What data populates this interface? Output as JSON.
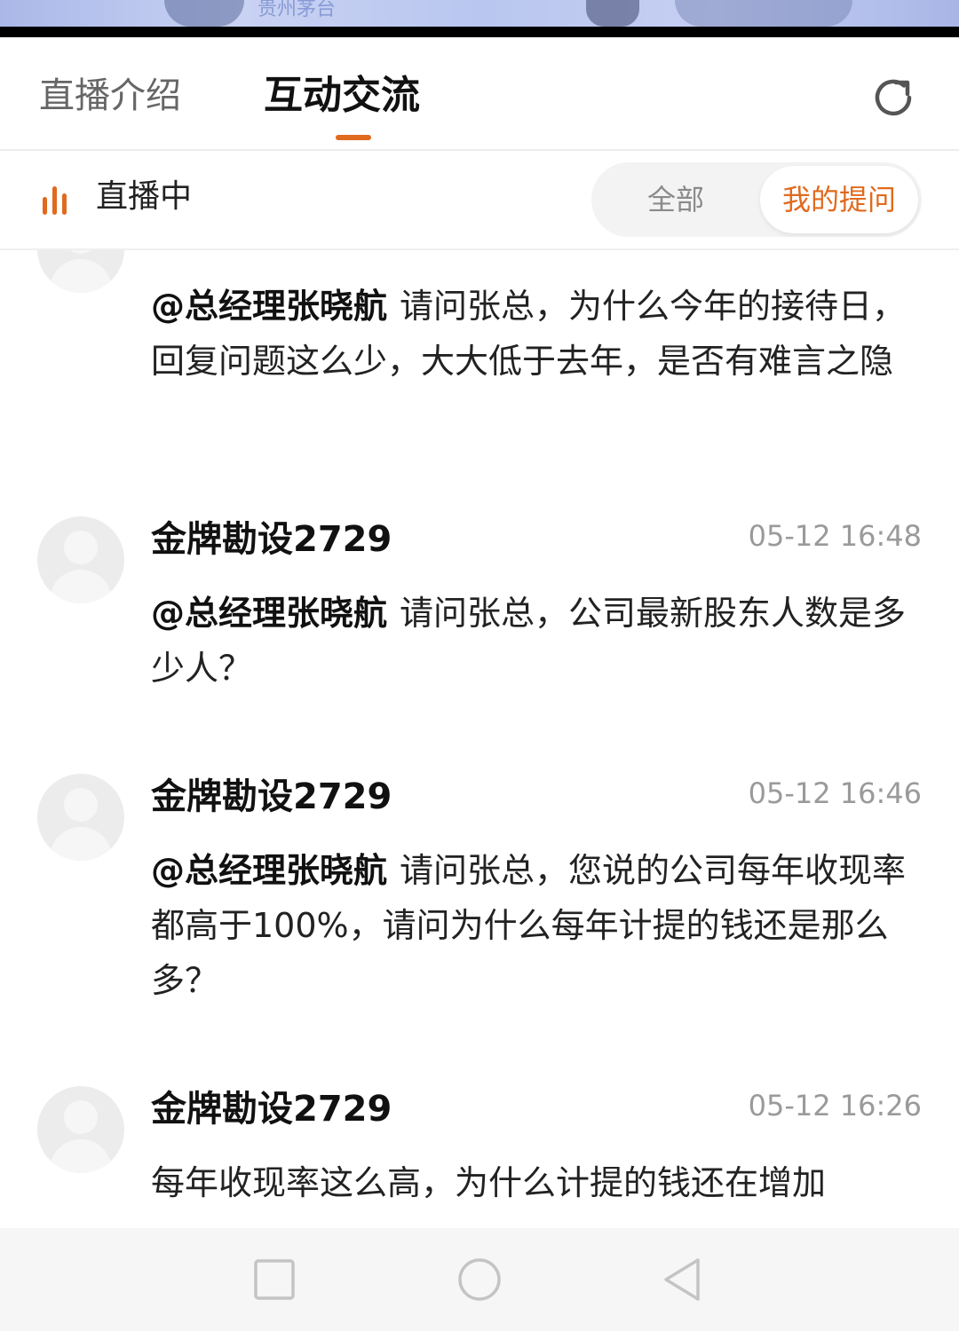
{
  "video": {
    "watermark": "贵州茅台"
  },
  "tabs": {
    "intro": "直播介绍",
    "chat": "互动交流"
  },
  "live": {
    "status": "直播中",
    "filter_all": "全部",
    "filter_mine": "我的提问"
  },
  "colors": {
    "accent": "#e06a1e"
  },
  "messages": [
    {
      "mention": "@总经理张晓航",
      "text": "请问张总，为什么今年的接待日，回复问题这么少，大大低于去年，是否有难言之隐"
    },
    {
      "user": "金牌勘设2729",
      "time": "05-12 16:48",
      "mention": "@总经理张晓航",
      "text": "请问张总，公司最新股东人数是多少人？"
    },
    {
      "user": "金牌勘设2729",
      "time": "05-12 16:46",
      "mention": "@总经理张晓航",
      "text": "请问张总，您说的公司每年收现率都高于100%，请问为什么每年计提的钱还是那么多？"
    },
    {
      "user": "金牌勘设2729",
      "time": "05-12 16:26",
      "text": "每年收现率这么高，为什么计提的钱还在增加"
    }
  ],
  "icons": {
    "refresh": "refresh-icon",
    "live": "live-bars-icon",
    "nav_recent": "square-icon",
    "nav_home": "circle-icon",
    "nav_back": "triangle-back-icon"
  }
}
